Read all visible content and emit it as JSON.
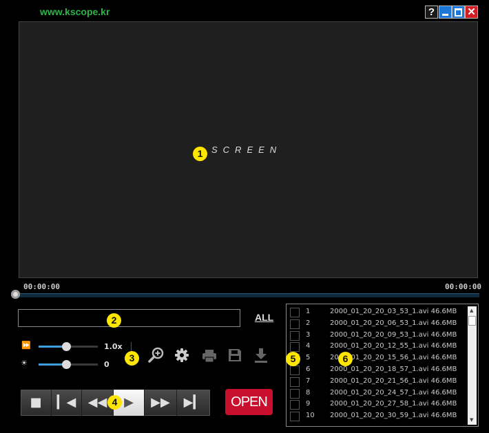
{
  "site": "www.kscope.kr",
  "window_buttons": {
    "help": "?",
    "close": "✕"
  },
  "screen": {
    "label": "SCREEN"
  },
  "markers": [
    "1",
    "2",
    "3",
    "4",
    "5",
    "6"
  ],
  "timeline": {
    "current": "00:00:00",
    "total": "00:00:00",
    "progress": 0
  },
  "info": {
    "all_label": "ALL"
  },
  "speed": {
    "value": "1.0x",
    "level": 0.5
  },
  "brightness": {
    "value": "0",
    "level": 0.5
  },
  "transport": {
    "open_label": "OPEN"
  },
  "icons": {
    "speed": "fast-forward-icon",
    "brightness": "sun-icon",
    "zoom": "zoom-in-icon",
    "settings": "gear-icon",
    "print": "printer-icon",
    "save": "save-icon",
    "download": "download-icon"
  },
  "files": [
    {
      "num": "1",
      "name": "2000_01_20_20_03_53_1.avi 46.6MB"
    },
    {
      "num": "2",
      "name": "2000_01_20_20_06_53_1.avi 46.6MB"
    },
    {
      "num": "3",
      "name": "2000_01_20_20_09_53_1.avi 46.6MB"
    },
    {
      "num": "4",
      "name": "2000_01_20_20_12_55_1.avi 46.6MB"
    },
    {
      "num": "5",
      "name": "2000_01_20_20_15_56_1.avi 46.6MB"
    },
    {
      "num": "6",
      "name": "2000_01_20_20_18_57_1.avi 46.6MB"
    },
    {
      "num": "7",
      "name": "2000_01_20_20_21_56_1.avi 46.6MB"
    },
    {
      "num": "8",
      "name": "2000_01_20_20_24_57_1.avi 46.6MB"
    },
    {
      "num": "9",
      "name": "2000_01_20_20_27_58_1.avi 46.6MB"
    },
    {
      "num": "10",
      "name": "2000_01_20_20_30_59_1.avi 46.6MB"
    }
  ]
}
